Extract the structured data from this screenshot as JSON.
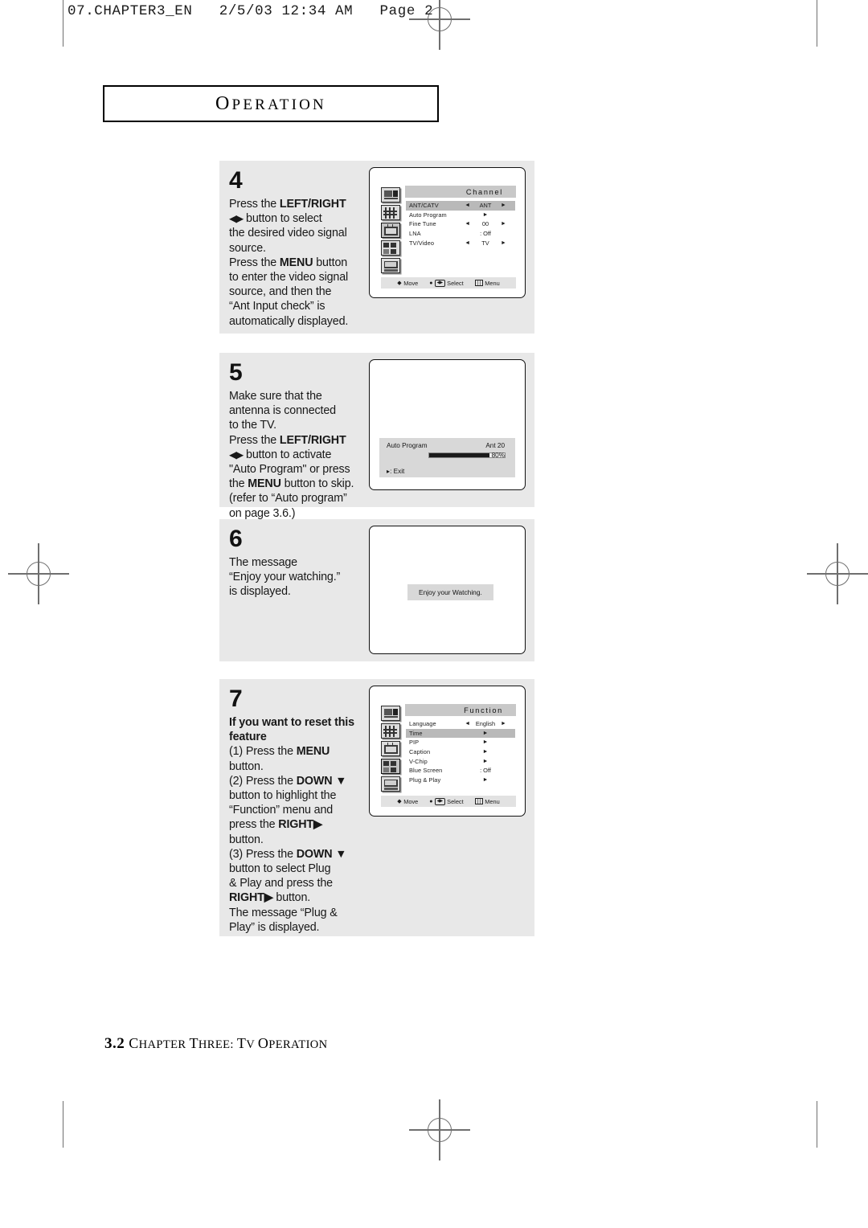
{
  "page_header": "07.CHAPTER3_EN   2/5/03 12:34 AM   Page 2",
  "section_title": "Operation",
  "footer": {
    "page_number": "3.2",
    "text": "Chapter Three: TV Operation"
  },
  "steps": [
    {
      "number": "4",
      "lines": [
        [
          {
            "t": "Press the ",
            "b": false
          },
          {
            "t": "LEFT/RIGHT",
            "b": true
          }
        ],
        [
          {
            "t": "◀▶",
            "b": false,
            "arrow": true
          },
          {
            "t": "  button to select",
            "b": false
          }
        ],
        [
          {
            "t": "the desired video signal",
            "b": false
          }
        ],
        [
          {
            "t": "source.",
            "b": false
          }
        ],
        [
          {
            "t": "Press the ",
            "b": false
          },
          {
            "t": "MENU",
            "b": true
          },
          {
            "t": " button",
            "b": false
          }
        ],
        [
          {
            "t": "to enter the video signal",
            "b": false
          }
        ],
        [
          {
            "t": "source, and then the",
            "b": false
          }
        ],
        [
          {
            "t": "“Ant Input check” is",
            "b": false
          }
        ],
        [
          {
            "t": "automatically displayed.",
            "b": false
          }
        ]
      ],
      "screen": "channel-menu"
    },
    {
      "number": "5",
      "lines": [
        [
          {
            "t": "Make sure that the",
            "b": false
          }
        ],
        [
          {
            "t": "antenna is connected",
            "b": false
          }
        ],
        [
          {
            "t": "to the TV.",
            "b": false
          }
        ],
        [
          {
            "t": "Press the ",
            "b": false
          },
          {
            "t": "LEFT/RIGHT",
            "b": true
          }
        ],
        [
          {
            "t": "◀▶",
            "b": false,
            "arrow": true
          },
          {
            "t": "  button to activate",
            "b": false
          }
        ],
        [
          {
            "t": "\"Auto Program\" or press",
            "b": false
          }
        ],
        [
          {
            "t": "the ",
            "b": false
          },
          {
            "t": "MENU",
            "b": true
          },
          {
            "t": " button to skip.",
            "b": false
          }
        ],
        [
          {
            "t": "(refer to “Auto program”",
            "b": false
          }
        ],
        [
          {
            "t": "on page 3.6.)",
            "b": false
          }
        ]
      ],
      "screen": "auto-program"
    },
    {
      "number": "6",
      "lines": [
        [
          {
            "t": "The message",
            "b": false
          }
        ],
        [
          {
            "t": "“Enjoy your watching.”",
            "b": false
          }
        ],
        [
          {
            "t": "is displayed.",
            "b": false
          }
        ]
      ],
      "screen": "enjoy-message"
    },
    {
      "number": "7",
      "lines": [
        [
          {
            "t": "If you want to reset this",
            "b": true
          }
        ],
        [
          {
            "t": "feature",
            "b": true
          }
        ],
        [
          {
            "t": "(1) Press the ",
            "b": false
          },
          {
            "t": "MENU",
            "b": true
          }
        ],
        [
          {
            "t": "      button.",
            "b": false
          }
        ],
        [
          {
            "t": "(2) Press the ",
            "b": false
          },
          {
            "t": "DOWN ▼",
            "b": true
          }
        ],
        [
          {
            "t": "      button to highlight the",
            "b": false
          }
        ],
        [
          {
            "t": "      “Function” menu and",
            "b": false
          }
        ],
        [
          {
            "t": "      press the ",
            "b": false
          },
          {
            "t": "RIGHT▶",
            "b": true
          }
        ],
        [
          {
            "t": "      button.",
            "b": false
          }
        ],
        [
          {
            "t": "(3) Press the ",
            "b": false
          },
          {
            "t": "DOWN ▼",
            "b": true
          }
        ],
        [
          {
            "t": "      button to select Plug",
            "b": false
          }
        ],
        [
          {
            "t": "      & Play and press the",
            "b": false
          }
        ],
        [
          {
            "t": "      ",
            "b": false
          },
          {
            "t": "RIGHT▶",
            "b": true
          },
          {
            "t": " button.",
            "b": false
          }
        ],
        [
          {
            "t": "      The message “Plug &",
            "b": false
          }
        ],
        [
          {
            "t": "      Play” is displayed.",
            "b": false
          }
        ]
      ],
      "screen": "function-menu"
    }
  ],
  "osd": {
    "sidebar_icons": [
      "picture-icon",
      "sound-icon",
      "channel-icon",
      "function-icon",
      "setup-icon"
    ],
    "hint_bar": {
      "move": "Move",
      "select": "Select",
      "menu": "Menu"
    },
    "channel_menu": {
      "title": "Channel",
      "selected_sidebar_index": 2,
      "items": [
        {
          "label": "ANT/CATV",
          "value": "ANT",
          "arrows": "both",
          "highlight": true
        },
        {
          "label": "Auto Program",
          "value": "",
          "arrows": "right",
          "highlight": false
        },
        {
          "label": "Fine Tune",
          "value": "00",
          "arrows": "both",
          "highlight": false
        },
        {
          "label": "LNA",
          "value": ": Off",
          "arrows": "none",
          "highlight": false
        },
        {
          "label": "TV/Video",
          "value": "TV",
          "arrows": "both",
          "highlight": false
        }
      ]
    },
    "function_menu": {
      "title": "Function",
      "selected_sidebar_index": 3,
      "items": [
        {
          "label": "Language",
          "value": "English",
          "arrows": "both",
          "highlight": false
        },
        {
          "label": "Time",
          "value": "",
          "arrows": "right",
          "highlight": true
        },
        {
          "label": "PIP",
          "value": "",
          "arrows": "right",
          "highlight": false
        },
        {
          "label": "Caption",
          "value": "",
          "arrows": "right",
          "highlight": false
        },
        {
          "label": "V-Chip",
          "value": "",
          "arrows": "right",
          "highlight": false
        },
        {
          "label": "Blue Screen",
          "value": ": Off",
          "arrows": "none",
          "highlight": false
        },
        {
          "label": "Plug & Play",
          "value": "",
          "arrows": "right",
          "highlight": false
        }
      ]
    },
    "auto_program": {
      "name": "Auto Program",
      "channel": "Ant 20",
      "percent": "80%",
      "progress": 80,
      "exit": "▸: Exit"
    },
    "enjoy_message": "Enjoy your Watching."
  }
}
